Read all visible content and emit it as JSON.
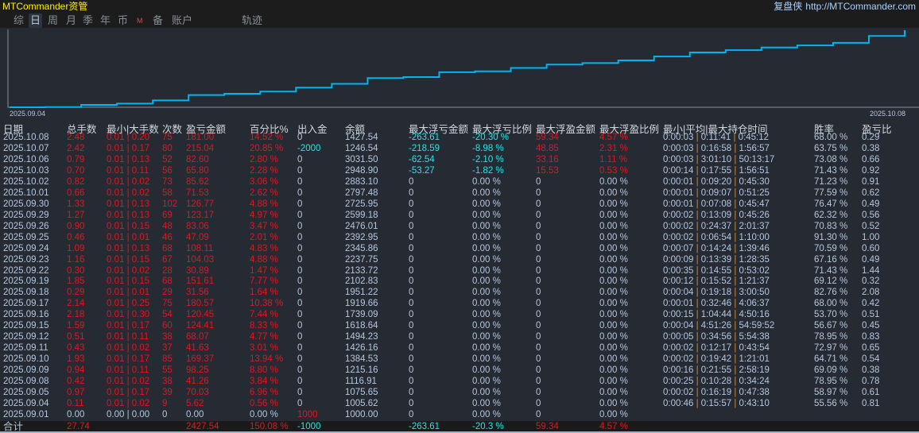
{
  "app_title": "MTCommander资管",
  "site": {
    "brand": "复盘侠",
    "url": "http://MTCommander.com"
  },
  "tabs": [
    {
      "label": "综"
    },
    {
      "label": "日",
      "active": true
    },
    {
      "label": "周"
    },
    {
      "label": "月"
    },
    {
      "label": "季"
    },
    {
      "label": "年"
    },
    {
      "label": "币"
    },
    {
      "label": "M"
    },
    {
      "label": "备"
    },
    {
      "label": "账户"
    },
    {
      "label": "轨迹"
    }
  ],
  "chart": {
    "x_start_label": "2025.09.04",
    "x_end_label": "2025.10.08",
    "line_color": "#00b4f0"
  },
  "columns": [
    "日期",
    "总手数",
    "最小|大手数",
    "次数",
    "盈亏金额",
    "百分比%",
    "出入金",
    "余额",
    "最大浮亏金额",
    "最大浮亏比例",
    "最大浮盈金额",
    "最大浮盈比例",
    "最小|平均|最大持仓时间",
    "胜率",
    "盈亏比"
  ],
  "rows": [
    [
      "2025.10.08",
      "2.48",
      "0.01|0.20",
      "75",
      "181.00",
      "14.52 %",
      "0",
      "1427.54",
      "-263.61",
      "-20.30 %",
      "59.34",
      "4.57 %",
      "0:00:03|0:11:41|0:45:12",
      "68.00 %",
      "0.29"
    ],
    [
      "2025.10.07",
      "2.42",
      "0.01|0.17",
      "80",
      "215.04",
      "20.85 %",
      "-2000",
      "1246.54",
      "-218.59",
      "-8.98 %",
      "48.85",
      "2.31 %",
      "0:00:03|0:16:58|1:56:57",
      "63.75 %",
      "0.38"
    ],
    [
      "2025.10.06",
      "0.79",
      "0.01|0.13",
      "52",
      "82.60",
      "2.80 %",
      "0",
      "3031.50",
      "-62.54",
      "-2.10 %",
      "33.16",
      "1.11 %",
      "0:00:03|3:01:10|50:13:17",
      "73.08 %",
      "0.66"
    ],
    [
      "2025.10.03",
      "0.70",
      "0.01|0.11",
      "56",
      "65.80",
      "2.28 %",
      "0",
      "2948.90",
      "-53.27",
      "-1.82 %",
      "15.53",
      "0.53 %",
      "0:00:14|0:17:55|1:56:51",
      "71.43 %",
      "0.92"
    ],
    [
      "2025.10.02",
      "0.82",
      "0.01|0.02",
      "73",
      "85.62",
      "3.06 %",
      "0",
      "2883.10",
      "0",
      "0.00 %",
      "0",
      "0.00 %",
      "0:00:01|0:09:20|0:45:30",
      "71.23 %",
      "0.91"
    ],
    [
      "2025.10.01",
      "0.66",
      "0.01|0.02",
      "58",
      "71.53",
      "2.62 %",
      "0",
      "2797.48",
      "0",
      "0.00 %",
      "0",
      "0.00 %",
      "0:00:01|0:09:07|0:51:25",
      "77.59 %",
      "0.62"
    ],
    [
      "2025.09.30",
      "1.33",
      "0.01|0.13",
      "102",
      "126.77",
      "4.88 %",
      "0",
      "2725.95",
      "0",
      "0.00 %",
      "0",
      "0.00 %",
      "0:00:01|0:07:08|0:45:47",
      "76.47 %",
      "0.49"
    ],
    [
      "2025.09.29",
      "1.27",
      "0.01|0.13",
      "69",
      "123.17",
      "4.97 %",
      "0",
      "2599.18",
      "0",
      "0.00 %",
      "0",
      "0.00 %",
      "0:00:02|0:13:09|0:45:26",
      "62.32 %",
      "0.56"
    ],
    [
      "2025.09.26",
      "0.90",
      "0.01|0.15",
      "48",
      "83.06",
      "3.47 %",
      "0",
      "2476.01",
      "0",
      "0.00 %",
      "0",
      "0.00 %",
      "0:00:02|0:24:37|2:01:37",
      "70.83 %",
      "0.52"
    ],
    [
      "2025.09.25",
      "0.46",
      "0.01|0.01",
      "46",
      "47.09",
      "2.01 %",
      "0",
      "2392.95",
      "0",
      "0.00 %",
      "0",
      "0.00 %",
      "0:00:02|0:06:54|1:10:00",
      "91.30 %",
      "1.00"
    ],
    [
      "2025.09.24",
      "1.09",
      "0.01|0.13",
      "68",
      "108.11",
      "4.83 %",
      "0",
      "2345.86",
      "0",
      "0.00 %",
      "0",
      "0.00 %",
      "0:00:07|0:14:24|1:39:46",
      "70.59 %",
      "0.60"
    ],
    [
      "2025.09.23",
      "1.16",
      "0.01|0.15",
      "67",
      "104.03",
      "4.88 %",
      "0",
      "2237.75",
      "0",
      "0.00 %",
      "0",
      "0.00 %",
      "0:00:09|0:13:39|1:28:35",
      "67.16 %",
      "0.49"
    ],
    [
      "2025.09.22",
      "0.30",
      "0.01|0.02",
      "28",
      "30.89",
      "1.47 %",
      "0",
      "2133.72",
      "0",
      "0.00 %",
      "0",
      "0.00 %",
      "0:00:35|0:14:55|0:53:02",
      "71.43 %",
      "1.44"
    ],
    [
      "2025.09.19",
      "1.85",
      "0.01|0.15",
      "68",
      "151.61",
      "7.77 %",
      "0",
      "2102.83",
      "0",
      "0.00 %",
      "0",
      "0.00 %",
      "0:00:12|0:15:52|1:21:37",
      "69.12 %",
      "0.32"
    ],
    [
      "2025.09.18",
      "0.29",
      "0.01|0.01",
      "29",
      "31.56",
      "1.64 %",
      "0",
      "1951.22",
      "0",
      "0.00 %",
      "0",
      "0.00 %",
      "0:00:04|0:19:18|3:00:50",
      "82.76 %",
      "2.08"
    ],
    [
      "2025.09.17",
      "2.14",
      "0.01|0.25",
      "75",
      "180.57",
      "10.38 %",
      "0",
      "1919.66",
      "0",
      "0.00 %",
      "0",
      "0.00 %",
      "0:00:01|0:32:46|4:06:37",
      "68.00 %",
      "0.42"
    ],
    [
      "2025.09.16",
      "2.18",
      "0.01|0.30",
      "54",
      "120.45",
      "7.44 %",
      "0",
      "1739.09",
      "0",
      "0.00 %",
      "0",
      "0.00 %",
      "0:00:15|1:04:44|4:50:16",
      "53.70 %",
      "0.51"
    ],
    [
      "2025.09.15",
      "1.59",
      "0.01|0.17",
      "60",
      "124.41",
      "8.33 %",
      "0",
      "1618.64",
      "0",
      "0.00 %",
      "0",
      "0.00 %",
      "0:00:04|4:51:26|54:59:52",
      "56.67 %",
      "0.45"
    ],
    [
      "2025.09.12",
      "0.51",
      "0.01|0.11",
      "38",
      "68.07",
      "4.77 %",
      "0",
      "1494.23",
      "0",
      "0.00 %",
      "0",
      "0.00 %",
      "0:00:05|0:34:56|5:54:38",
      "78.95 %",
      "0.83"
    ],
    [
      "2025.09.11",
      "0.43",
      "0.01|0.02",
      "37",
      "41.63",
      "3.01 %",
      "0",
      "1426.16",
      "0",
      "0.00 %",
      "0",
      "0.00 %",
      "0:00:02|0:12:17|0:43:54",
      "72.97 %",
      "0.65"
    ],
    [
      "2025.09.10",
      "1.93",
      "0.01|0.17",
      "85",
      "169.37",
      "13.94 %",
      "0",
      "1384.53",
      "0",
      "0.00 %",
      "0",
      "0.00 %",
      "0:00:02|0:19:42|1:21:01",
      "64.71 %",
      "0.54"
    ],
    [
      "2025.09.09",
      "0.94",
      "0.01|0.11",
      "55",
      "98.25",
      "8.80 %",
      "0",
      "1215.16",
      "0",
      "0.00 %",
      "0",
      "0.00 %",
      "0:00:16|0:21:55|2:58:19",
      "69.09 %",
      "0.38"
    ],
    [
      "2025.09.08",
      "0.42",
      "0.01|0.02",
      "38",
      "41.26",
      "3.84 %",
      "0",
      "1116.91",
      "0",
      "0.00 %",
      "0",
      "0.00 %",
      "0:00:25|0:10:28|0:34:24",
      "78.95 %",
      "0.78"
    ],
    [
      "2025.09.05",
      "0.97",
      "0.01|0.17",
      "39",
      "70.03",
      "6.96 %",
      "0",
      "1075.65",
      "0",
      "0.00 %",
      "0",
      "0.00 %",
      "0:00:02|0:16:19|0:47:38",
      "58.97 %",
      "0.61"
    ],
    [
      "2025.09.04",
      "0.11",
      "0.01|0.02",
      "9",
      "5.62",
      "0.56 %",
      "0",
      "1005.62",
      "0",
      "0.00 %",
      "0",
      "0.00 %",
      "0:00:46|0:15:57|0:43:10",
      "55.56 %",
      "0.81"
    ],
    [
      "2025.09.01",
      "0.00",
      "0.00|0.00",
      "0",
      "0.00",
      "0.00 %",
      "1000",
      "1000.00",
      "0",
      "0.00 %",
      "0",
      "0.00 %",
      "",
      "",
      ""
    ]
  ],
  "total": {
    "label": "合计",
    "lots": "27.74",
    "pnl": "2427.54",
    "pct": "150.08 %",
    "flow": "-1000",
    "max_float_loss": "-263.61",
    "max_float_loss_pct": "-20.3 %",
    "max_float_profit": "59.34",
    "max_float_profit_pct": "4.57 %"
  },
  "colors": {
    "red": "#e8141e",
    "cyan": "#1ee8e8",
    "text": "#b4c8e0",
    "title": "#ffee00"
  }
}
